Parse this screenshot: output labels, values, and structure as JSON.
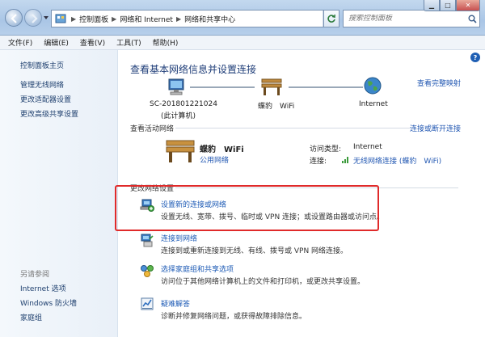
{
  "address": {
    "crumbs": [
      "控制面板",
      "网络和 Internet",
      "网络和共享中心"
    ],
    "search_placeholder": "搜索控制面板"
  },
  "menu": [
    "文件(F)",
    "编辑(E)",
    "查看(V)",
    "工具(T)",
    "帮助(H)"
  ],
  "left_pane": {
    "home": "控制面板主页",
    "links": [
      "管理无线网络",
      "更改适配器设置",
      "更改高级共享设置"
    ],
    "see_also_title": "另请参阅",
    "see_also": [
      "Internet 选项",
      "Windows 防火墙",
      "家庭组"
    ]
  },
  "main": {
    "title": "查看基本网络信息并设置连接",
    "see_full_map": "查看完整映射",
    "map": {
      "computer_name": "SC-201801221024",
      "computer_sub": "(此计算机)",
      "network_name": "蝶豹　WiFi",
      "internet": "Internet"
    },
    "active_title": "查看活动网络",
    "connect_disconnect": "连接或断开连接",
    "active": {
      "name": "蝶豹　WiFi",
      "type": "公用网络",
      "access_label": "访问类型:",
      "access_value": "Internet",
      "conn_label": "连接:",
      "conn_value": "无线网络连接 (蝶豹　WiFi)"
    },
    "change_title": "更改网络设置",
    "tasks": [
      {
        "title": "设置新的连接或网络",
        "desc": "设置无线、宽带、拨号、临时或 VPN 连接；或设置路由器或访问点。"
      },
      {
        "title": "连接到网络",
        "desc": "连接到或重新连接到无线、有线、拨号或 VPN 网络连接。"
      },
      {
        "title": "选择家庭组和共享选项",
        "desc": "访问位于其他网络计算机上的文件和打印机，或更改共享设置。"
      },
      {
        "title": "疑难解答",
        "desc": "诊断并修复网络问题，或获得故障排除信息。"
      }
    ]
  }
}
